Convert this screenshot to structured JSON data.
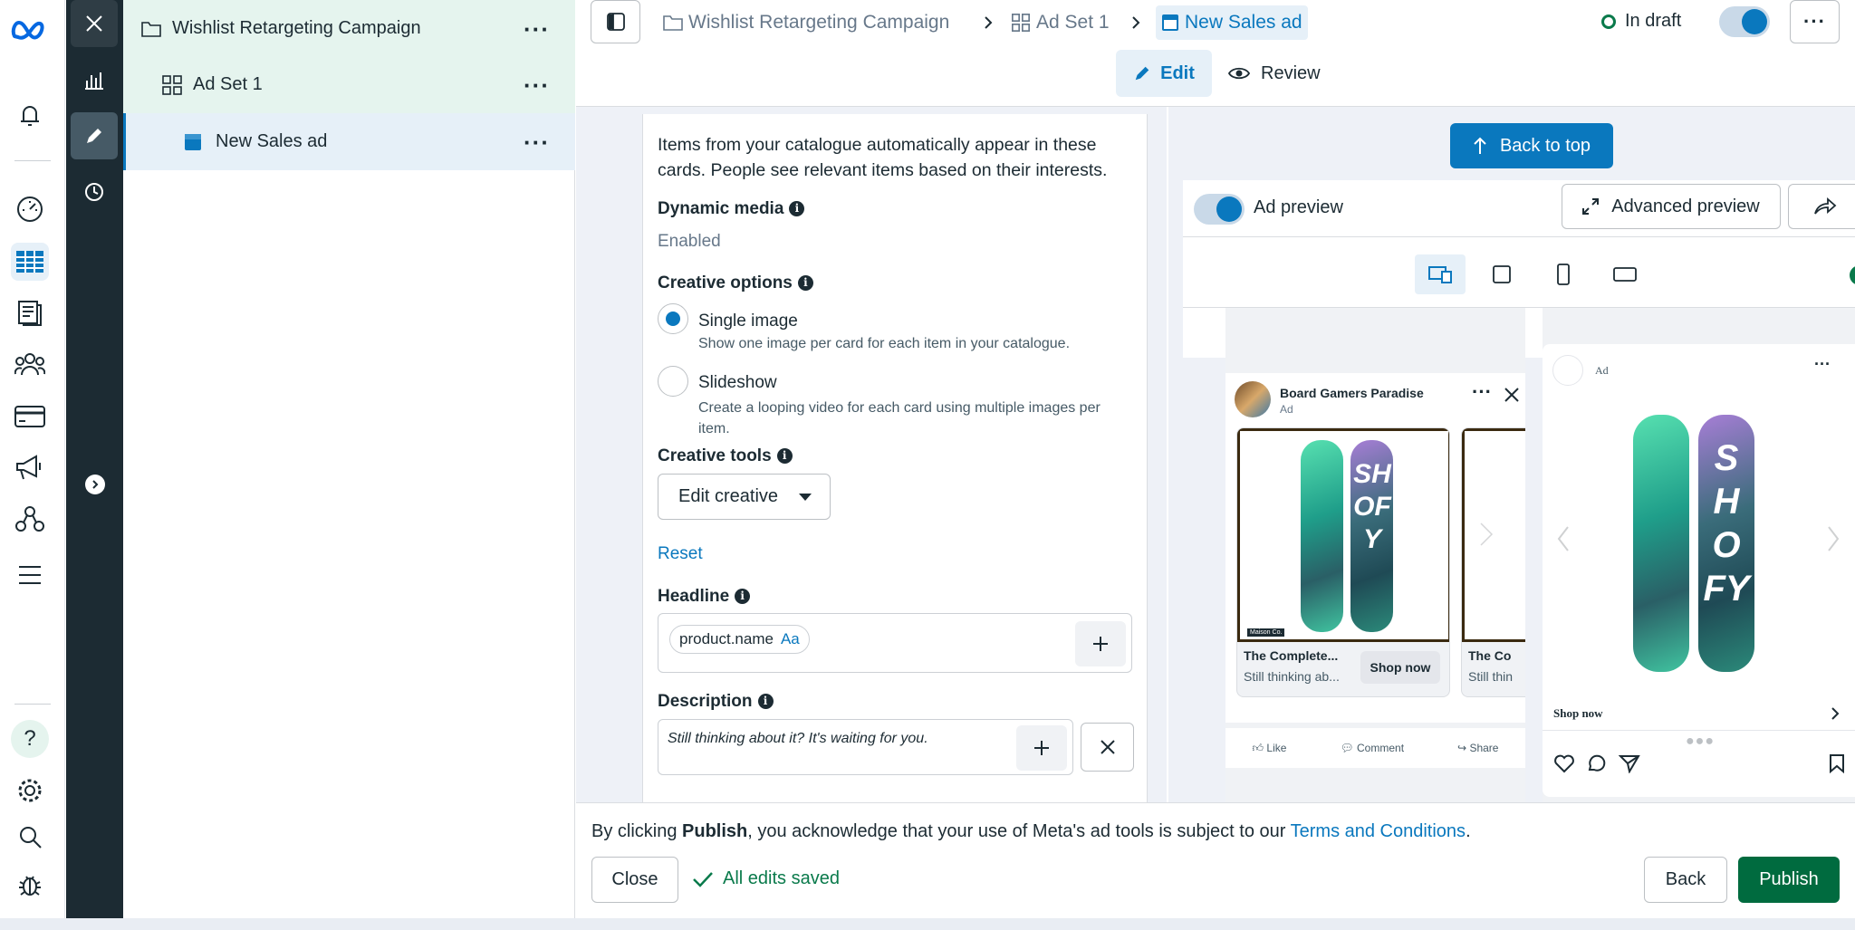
{
  "left_rail": {
    "brand_icon": "meta-logo-icon",
    "items": [
      "notifications-bell-icon",
      "dashboard-gauge-icon",
      "ads-manager-table-icon",
      "pages-icon",
      "audience-people-icon",
      "billing-card-icon",
      "campaign-megaphone-icon",
      "business-network-icon",
      "menu-lines-icon"
    ],
    "bottom_items": [
      "help-question-icon",
      "settings-gear-icon",
      "search-icon",
      "debug-bug-icon"
    ]
  },
  "dark_rail": {
    "items": [
      "close-icon",
      "chart-bars-icon",
      "edit-pencil-icon",
      "history-clock-icon"
    ],
    "expand_icon": "chevron-right-icon"
  },
  "tree": {
    "campaign": "Wishlist Retargeting Campaign",
    "adset": "Ad Set 1",
    "ad": "New Sales ad"
  },
  "header": {
    "crumbs": [
      "Wishlist Retargeting Campaign",
      "Ad Set 1",
      "New Sales ad"
    ],
    "status": "In draft",
    "tabs": {
      "edit": "Edit",
      "review": "Review"
    },
    "toggle_on": true
  },
  "form": {
    "intro": "Items from your catalogue automatically appear in these cards. People see relevant items based on their interests.",
    "dynamic_media_label": "Dynamic media",
    "dynamic_media_value": "Enabled",
    "creative_options_label": "Creative options",
    "options": [
      {
        "title": "Single image",
        "desc": "Show one image per card for each item in your catalogue.",
        "selected": true
      },
      {
        "title": "Slideshow",
        "desc": "Create a looping video for each card using multiple images per item.",
        "selected": false
      }
    ],
    "creative_tools_label": "Creative tools",
    "edit_creative": "Edit creative",
    "reset": "Reset",
    "headline_label": "Headline",
    "headline_token": "product.name",
    "headline_token_suffix": "Aa",
    "description_label": "Description",
    "description_text": "Still thinking about it? It's waiting for you."
  },
  "preview": {
    "back_to_top": "Back to top",
    "ad_preview_label": "Ad preview",
    "advanced_preview": "Advanced preview",
    "fb": {
      "page_name": "Board Gamers Paradise",
      "ad_label": "Ad",
      "card_title": "The Complete...",
      "card_sub": "Still thinking ab...",
      "card2_title": "The Co",
      "card2_sub": "Still thin",
      "shop_now": "Shop now",
      "brand_tag": "Maison Co.",
      "like": "Like",
      "comment": "Comment",
      "share": "Share"
    },
    "ig": {
      "ad_label": "Ad",
      "shop_now": "Shop now"
    },
    "board_text": "SHOFY"
  },
  "footer": {
    "notice_prefix": "By clicking ",
    "notice_bold": "Publish",
    "notice_mid": ", you acknowledge that your use of Meta's ad tools is subject to our ",
    "notice_link": "Terms and Conditions",
    "notice_end": ".",
    "close": "Close",
    "saved": "All edits saved",
    "back": "Back",
    "publish": "Publish"
  },
  "colors": {
    "accent": "#0a78be",
    "publish": "#006b3f",
    "tree_highlight": "#e5f4ee",
    "tree_selected": "#e6f0f8",
    "dark_rail": "#1c2b33"
  }
}
